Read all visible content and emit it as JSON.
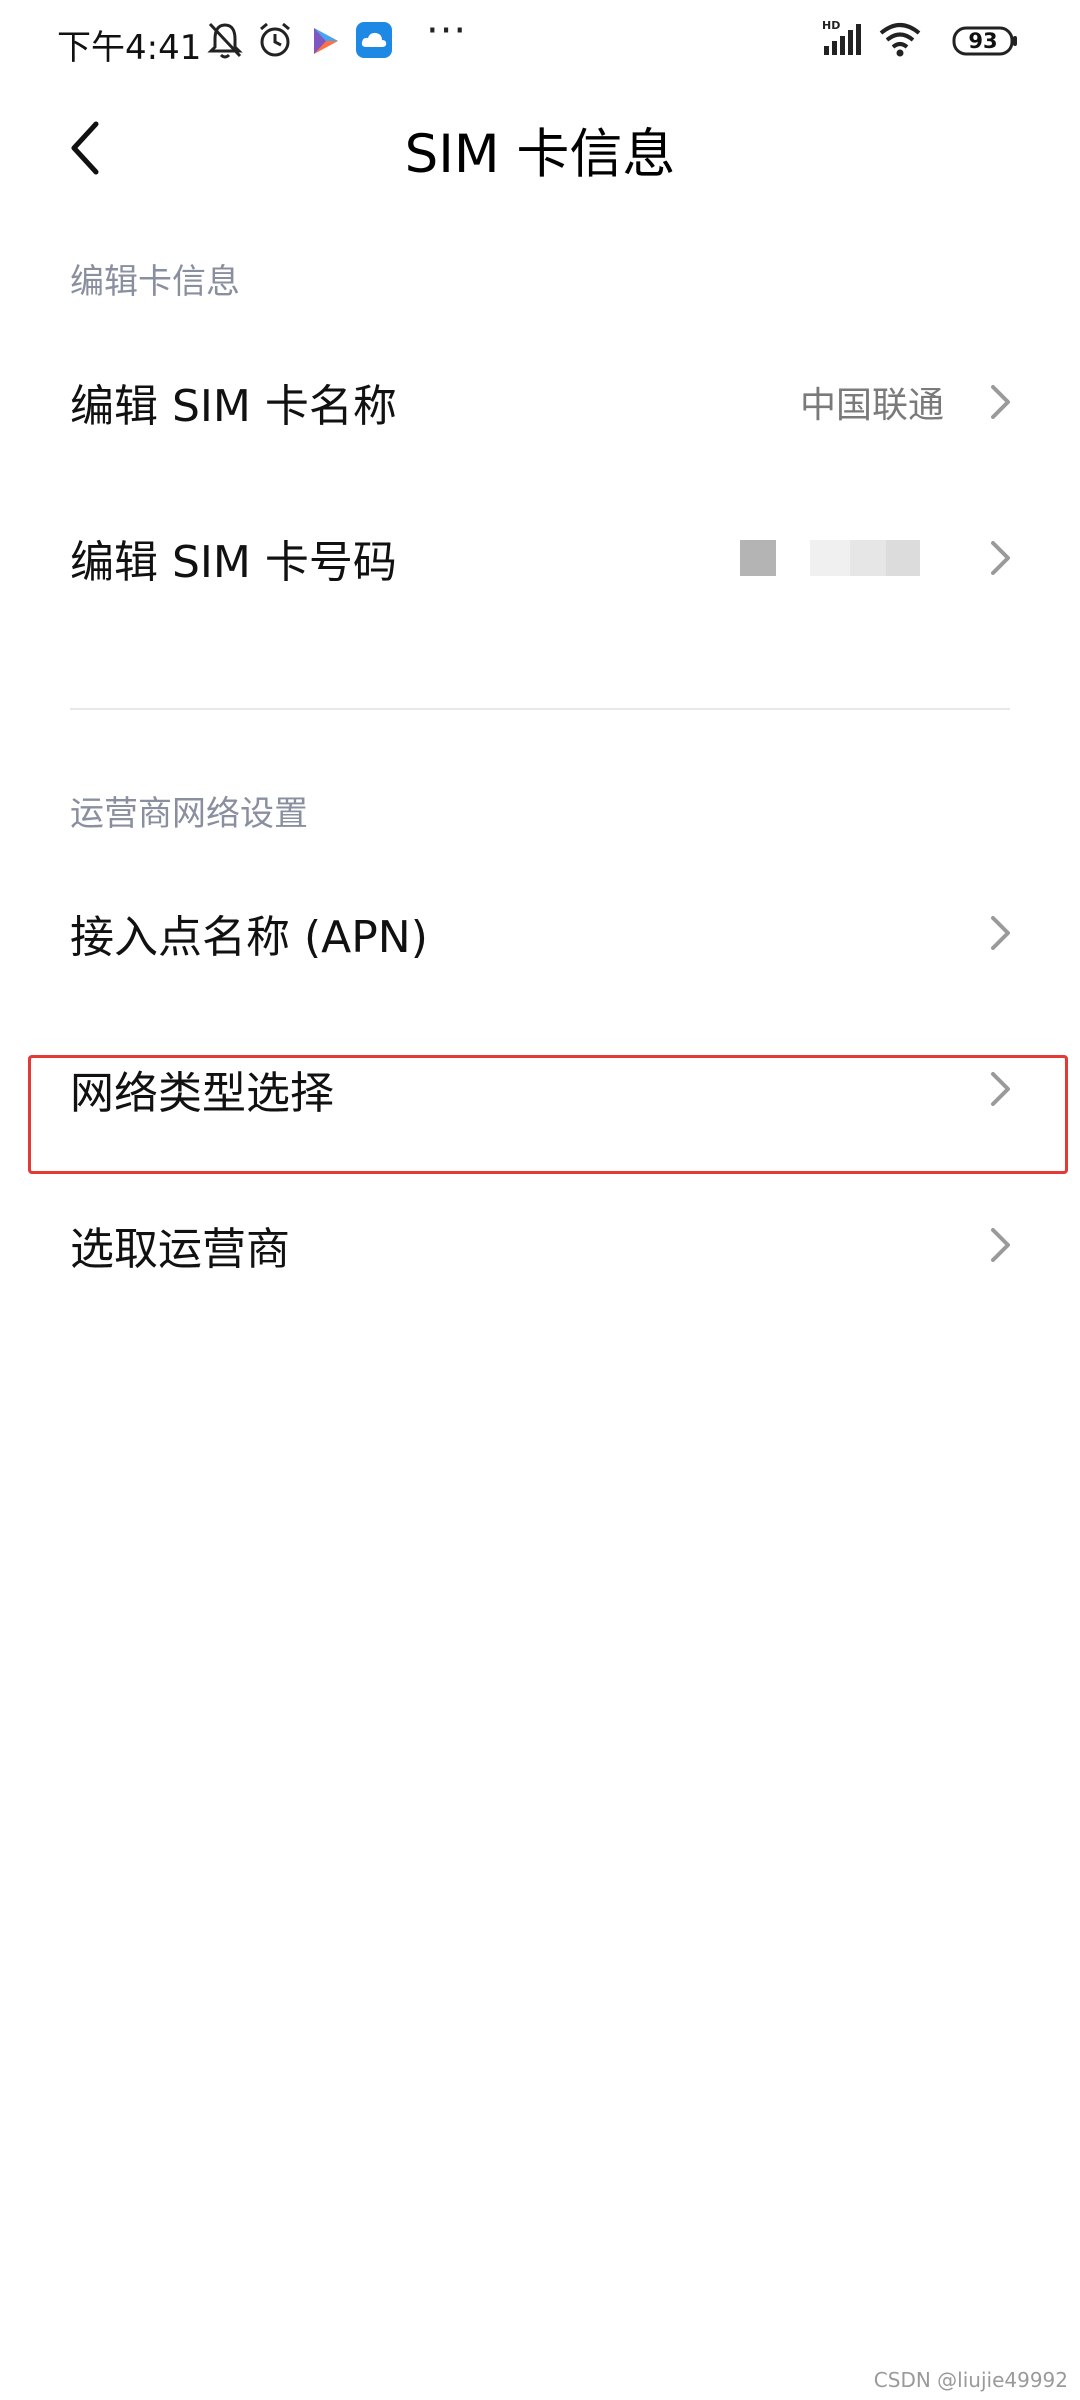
{
  "status_bar": {
    "time": "下午4:41",
    "network_badge": "HD",
    "battery": "93",
    "more": "···"
  },
  "header": {
    "title": "SIM 卡信息"
  },
  "sections": [
    {
      "header": "编辑卡信息",
      "items": [
        {
          "label": "编辑 SIM 卡名称",
          "value": "中国联通"
        },
        {
          "label": "编辑 SIM 卡号码",
          "value": ""
        }
      ]
    },
    {
      "header": "运营商网络设置",
      "items": [
        {
          "label": "接入点名称 (APN)"
        },
        {
          "label": "网络类型选择"
        },
        {
          "label": "选取运营商"
        }
      ]
    }
  ],
  "watermark": "CSDN @liujie49992",
  "colors": {
    "section_header": "#8a8fa0",
    "highlight": "#e53935",
    "chevron": "#9a9a9a"
  }
}
